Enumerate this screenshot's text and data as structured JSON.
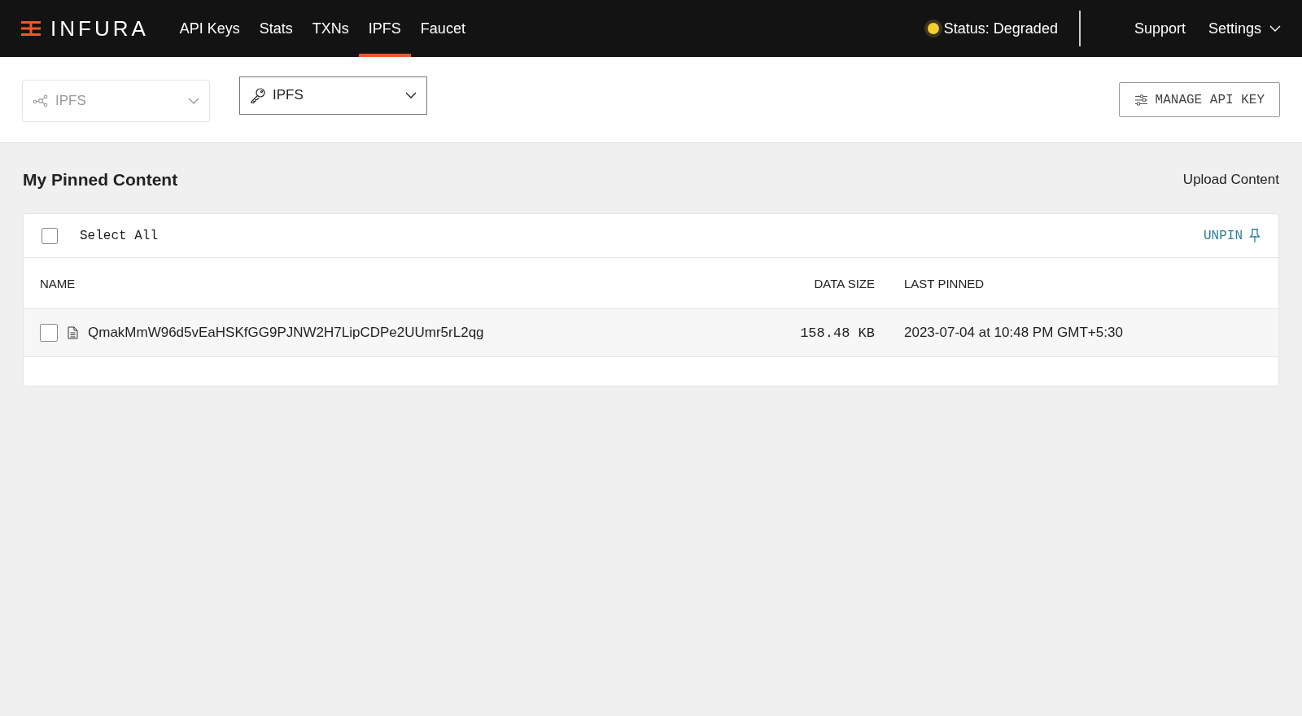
{
  "header": {
    "logo": "INFURA",
    "nav": [
      {
        "label": "API Keys",
        "selected": false
      },
      {
        "label": "Stats",
        "selected": false
      },
      {
        "label": "TXNs",
        "selected": false
      },
      {
        "label": "IPFS",
        "selected": true
      },
      {
        "label": "Faucet",
        "selected": false
      }
    ],
    "status": {
      "label": "Status: Degraded",
      "color": "#f5cf2c"
    },
    "links": [
      {
        "label": "Support",
        "kind": "link"
      },
      {
        "label": "Settings",
        "kind": "menu"
      }
    ]
  },
  "toolbar": {
    "selects": [
      {
        "kind": "network",
        "value": "IPFS",
        "disabled": true
      },
      {
        "kind": "key",
        "value": "IPFS",
        "disabled": false
      }
    ],
    "manage_button": "MANAGE API KEY"
  },
  "section": {
    "title": "My Pinned Content",
    "upload_link": "Upload Content"
  },
  "table": {
    "select_all": {
      "label": "Select All",
      "checked": false
    },
    "unpin_button": "UNPIN",
    "columns": [
      "NAME",
      "DATA SIZE",
      "LAST PINNED"
    ],
    "rows": [
      {
        "name": "QmakMmW96d5vEaHSKfGG9PJNW2H7LipCDPe2UUmr5rL2qg",
        "size": "158.48 KB",
        "last_pinned": "2023-07-04 at 10:48 PM GMT+5:30",
        "checked": false
      }
    ]
  }
}
